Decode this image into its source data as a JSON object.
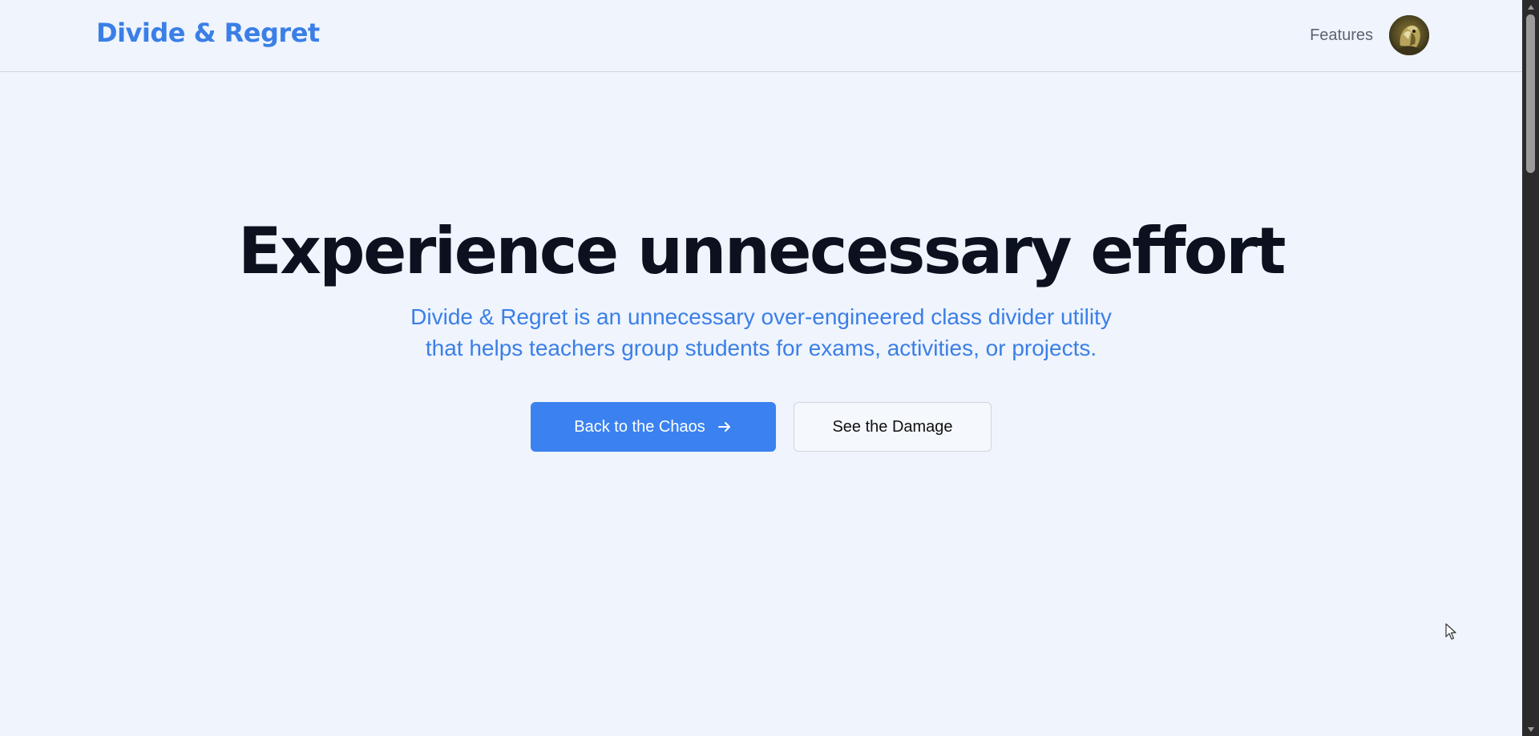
{
  "brand": {
    "name": "Divide & Regret",
    "color": "#3b7fe6"
  },
  "nav": {
    "links": [
      {
        "label": "Features"
      }
    ],
    "avatar": {
      "icon": "user-avatar"
    }
  },
  "hero": {
    "title": "Experience unnecessary effort",
    "subtitle": "Divide & Regret is an unnecessary over-engineered class divider utility that helps teachers group students for exams, activities, or projects.",
    "primary_cta": {
      "label": "Back to the Chaos",
      "icon": "arrow-right-icon"
    },
    "secondary_cta": {
      "label": "See the Damage"
    }
  },
  "colors": {
    "background": "#eff4fd",
    "primary": "#3b82f0",
    "title_text": "#0c1120",
    "subtitle_text": "#3b7fe6"
  }
}
